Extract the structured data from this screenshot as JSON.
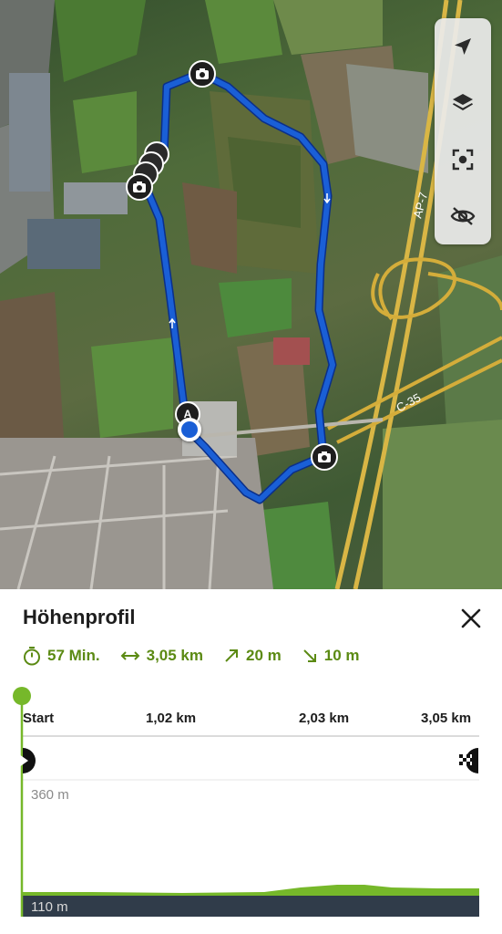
{
  "map": {
    "road_labels": [
      "AP-7",
      "C-35"
    ],
    "start_marker_label": "A",
    "controls": [
      "navigate-icon",
      "layers-icon",
      "recenter-icon",
      "hide-icon"
    ],
    "route_color": "#1a5fd6"
  },
  "elevation_panel": {
    "title": "Höhenprofil",
    "stats": {
      "duration": "57 Min.",
      "distance": "3,05 km",
      "ascent": "20 m",
      "descent": "10 m"
    },
    "accent_color": "#76b82a",
    "distance_ticks": [
      "Start",
      "1,02 km",
      "2,03 km",
      "3,05 km"
    ],
    "altitude_top": "360 m",
    "altitude_bottom": "110 m"
  }
}
